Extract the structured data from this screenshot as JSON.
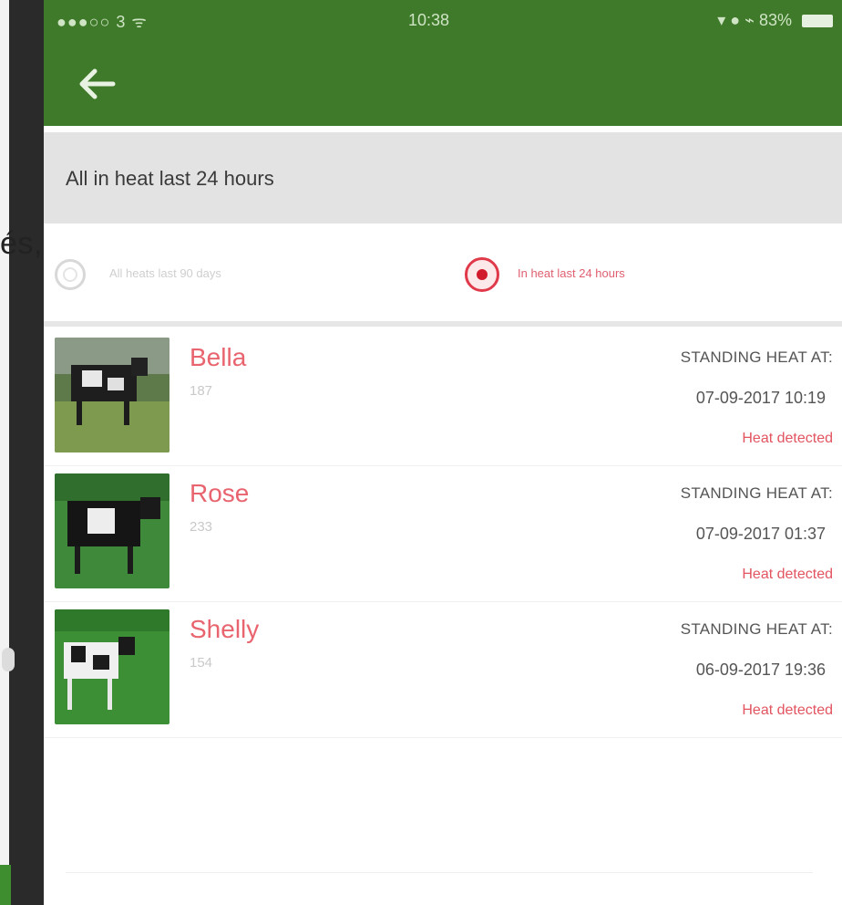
{
  "status_bar": {
    "carrier": "●●●○○ 3 ᯤ",
    "time": "10:38",
    "right": "▾ ● ⌁ 83%"
  },
  "appbar": {
    "back_icon": "arrow-left-icon"
  },
  "section": {
    "title": "All in heat last 24 hours"
  },
  "filters": {
    "option_a": {
      "label": "All heats last 90 days",
      "selected": false
    },
    "option_b": {
      "label": "In heat last 24 hours",
      "selected": true
    }
  },
  "cows": [
    {
      "name": "Bella",
      "id": "187",
      "standing_label": "STANDING HEAT AT:",
      "datetime": "07-09-2017 10:19",
      "status": "Heat detected"
    },
    {
      "name": "Rose",
      "id": "233",
      "standing_label": "STANDING HEAT AT:",
      "datetime": "07-09-2017 01:37",
      "status": "Heat detected"
    },
    {
      "name": "Shelly",
      "id": "154",
      "standing_label": "STANDING HEAT AT:",
      "datetime": "06-09-2017 19:36",
      "status": "Heat detected"
    }
  ],
  "overlay": {
    "stray_text": "és,"
  },
  "colors": {
    "appbar": "#3f7a2a",
    "accent": "#e8646e",
    "radio_selected": "#d11a2c"
  }
}
